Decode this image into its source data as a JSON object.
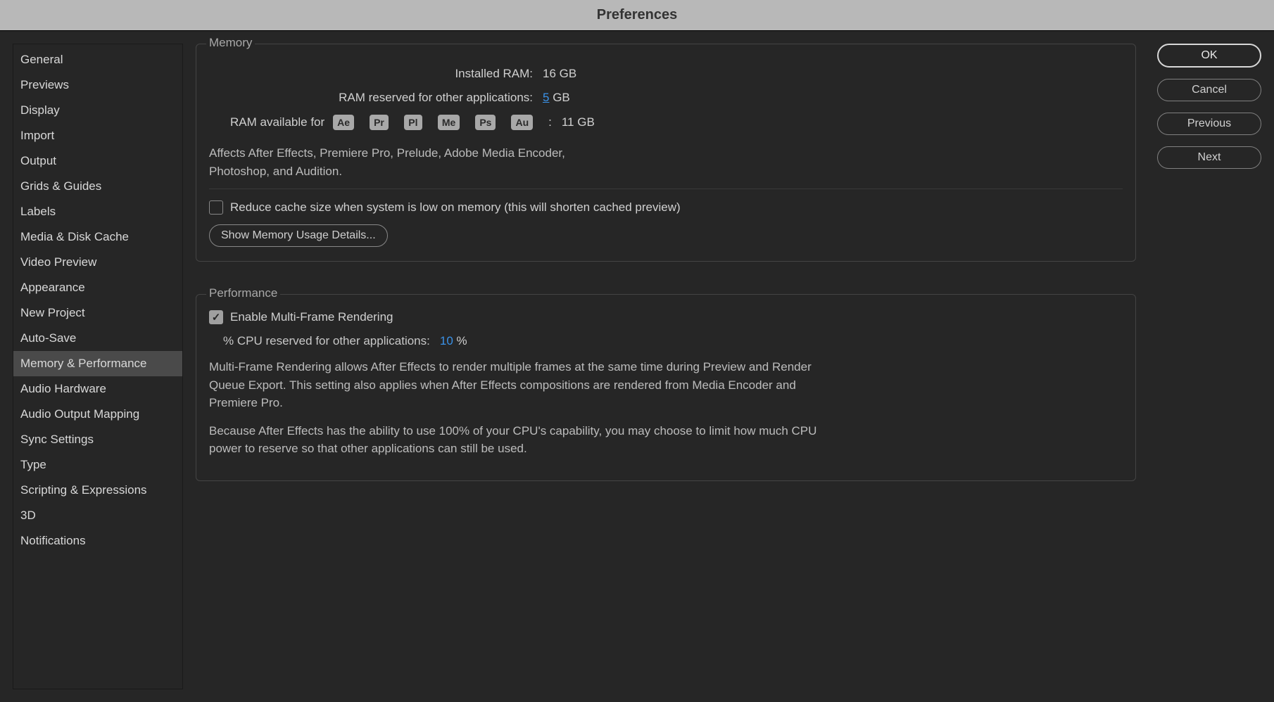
{
  "window": {
    "title": "Preferences"
  },
  "sidebar": {
    "items": [
      {
        "label": "General",
        "selected": false
      },
      {
        "label": "Previews",
        "selected": false
      },
      {
        "label": "Display",
        "selected": false
      },
      {
        "label": "Import",
        "selected": false
      },
      {
        "label": "Output",
        "selected": false
      },
      {
        "label": "Grids & Guides",
        "selected": false
      },
      {
        "label": "Labels",
        "selected": false
      },
      {
        "label": "Media & Disk Cache",
        "selected": false
      },
      {
        "label": "Video Preview",
        "selected": false
      },
      {
        "label": "Appearance",
        "selected": false
      },
      {
        "label": "New Project",
        "selected": false
      },
      {
        "label": "Auto-Save",
        "selected": false
      },
      {
        "label": "Memory & Performance",
        "selected": true
      },
      {
        "label": "Audio Hardware",
        "selected": false
      },
      {
        "label": "Audio Output Mapping",
        "selected": false
      },
      {
        "label": "Sync Settings",
        "selected": false
      },
      {
        "label": "Type",
        "selected": false
      },
      {
        "label": "Scripting & Expressions",
        "selected": false
      },
      {
        "label": "3D",
        "selected": false
      },
      {
        "label": "Notifications",
        "selected": false
      }
    ]
  },
  "memory": {
    "legend": "Memory",
    "installed_label": "Installed RAM:",
    "installed_value": "16 GB",
    "reserved_label": "RAM reserved for other applications:",
    "reserved_value": "5",
    "reserved_unit": " GB",
    "available_label": "RAM available for",
    "apps": [
      "Ae",
      "Pr",
      "Pl",
      "Me",
      "Ps",
      "Au"
    ],
    "available_colon": ":",
    "available_value": "11 GB",
    "affects_text": "Affects After Effects, Premiere Pro, Prelude, Adobe Media Encoder, Photoshop, and Audition.",
    "reduce_cache_label": "Reduce cache size when system is low on memory (this will shorten cached preview)",
    "reduce_cache_checked": false,
    "show_details_label": "Show Memory Usage Details..."
  },
  "performance": {
    "legend": "Performance",
    "enable_mfr_label": "Enable Multi-Frame Rendering",
    "enable_mfr_checked": true,
    "cpu_reserved_label": "% CPU reserved for other applications:",
    "cpu_reserved_value": "10",
    "cpu_reserved_unit": " %",
    "mfr_desc": "Multi-Frame Rendering allows After Effects to render multiple frames at the same time during Preview and Render Queue Export. This setting also applies when After Effects compositions are rendered from Media Encoder and Premiere Pro.",
    "cpu_desc": "Because After Effects has the ability to use 100% of your CPU's capability, you may choose to limit how much CPU power to reserve so that other applications can still be used."
  },
  "buttons": {
    "ok": "OK",
    "cancel": "Cancel",
    "previous": "Previous",
    "next": "Next"
  }
}
